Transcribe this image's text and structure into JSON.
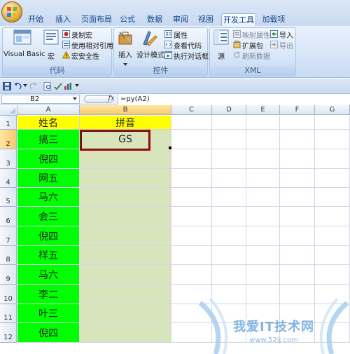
{
  "ribbon": {
    "tabs": [
      "开始",
      "插入",
      "页面布局",
      "公式",
      "数据",
      "审阅",
      "视图",
      "开发工具",
      "加载项"
    ],
    "active_tab": "开发工具",
    "code_group": {
      "label": "代码",
      "visual_basic": "Visual Basic",
      "macro": "宏",
      "record_macro": "录制宏",
      "relative_ref": "使用相对引用",
      "macro_security": "宏安全性"
    },
    "controls_group": {
      "label": "控件",
      "insert": "插入",
      "design_mode": "设计模式",
      "properties": "属性",
      "view_code": "查看代码",
      "run_dialog": "执行对话框"
    },
    "xml_group": {
      "label": "XML",
      "source": "源",
      "map_properties": "映射属性",
      "expansion_packs": "扩展包",
      "refresh_data": "刷新数据",
      "import": "导入",
      "export": "导出"
    }
  },
  "formula_bar": {
    "name_box": "B2",
    "fx": "fx",
    "formula": "=py(A2)"
  },
  "sheet": {
    "columns": [
      "A",
      "B",
      "C",
      "D",
      "E",
      "F",
      "G"
    ],
    "rows": [
      "1",
      "2",
      "3",
      "4",
      "5",
      "6",
      "7",
      "8",
      "9",
      "10",
      "11",
      "12"
    ],
    "header_row": {
      "a": "姓名",
      "b": "拼音"
    },
    "names": [
      "搞三",
      "倪四",
      "网五",
      "马六",
      "会三",
      "倪四",
      "样五",
      "马六",
      "李二",
      "叶三",
      "倪四"
    ],
    "pinyin": [
      "GS",
      "",
      "",
      "",
      "",
      "",
      "",
      "",
      "",
      "",
      ""
    ],
    "colors": {
      "header_fill": "#ffff00",
      "name_fill": "#00ff00",
      "pinyin_fill": "#d8e4bc",
      "selection_border": "#c00000"
    }
  },
  "watermark": {
    "text": "我爱IT技术网",
    "url": "www.52ij.com"
  }
}
